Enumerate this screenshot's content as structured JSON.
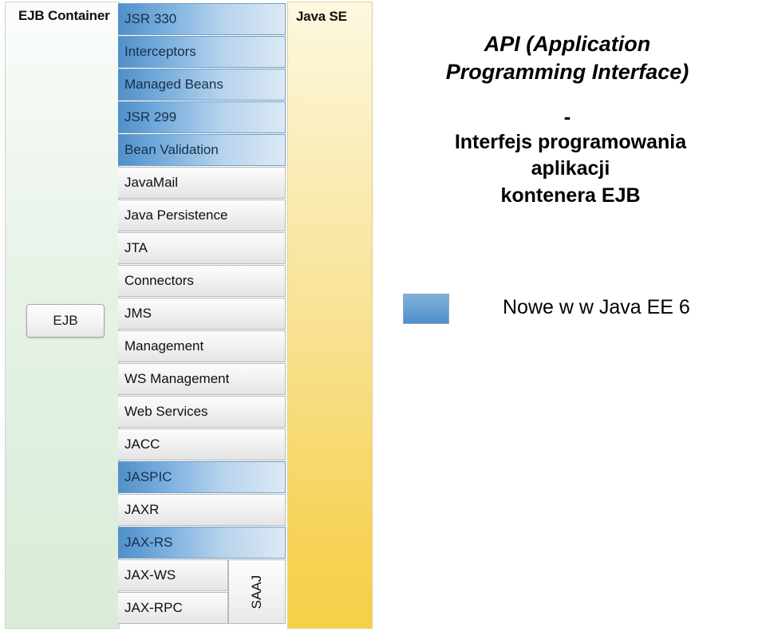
{
  "diagram": {
    "ejb_container": {
      "title": "EJB Container",
      "inner_box_label": "EJB"
    },
    "java_se": {
      "title": "Java SE"
    },
    "legend": {
      "swatch_color": "#4e8fca",
      "label": "Nowe w w Java EE 6"
    },
    "services": [
      {
        "label": "JSR 330",
        "highlight": true
      },
      {
        "label": "Interceptors",
        "highlight": true
      },
      {
        "label": "Managed Beans",
        "highlight": true
      },
      {
        "label": "JSR 299",
        "highlight": true
      },
      {
        "label": "Bean Validation",
        "highlight": true
      },
      {
        "label": "JavaMail",
        "highlight": false
      },
      {
        "label": "Java Persistence",
        "highlight": false
      },
      {
        "label": "JTA",
        "highlight": false
      },
      {
        "label": "Connectors",
        "highlight": false
      },
      {
        "label": "JMS",
        "highlight": false
      },
      {
        "label": "Management",
        "highlight": false
      },
      {
        "label": "WS Management",
        "highlight": false
      },
      {
        "label": "Web Services",
        "highlight": false
      },
      {
        "label": "JACC",
        "highlight": false
      },
      {
        "label": "JASPIC",
        "highlight": true
      },
      {
        "label": "JAXR",
        "highlight": false
      },
      {
        "label": "JAX-RS",
        "highlight": true
      },
      {
        "label": "JAX-WS",
        "highlight": false,
        "split": true
      },
      {
        "label": "JAX-RPC",
        "highlight": false,
        "split": true
      }
    ],
    "saaj": {
      "label": "SAAJ"
    }
  },
  "text_panel": {
    "heading_line_1": "API (Application",
    "heading_line_2": "Programming Interface)",
    "dash": "-",
    "subtext_line_1": "Interfejs programowania",
    "subtext_line_2": "aplikacji",
    "subtext_line_3": "kontenera EJB"
  }
}
